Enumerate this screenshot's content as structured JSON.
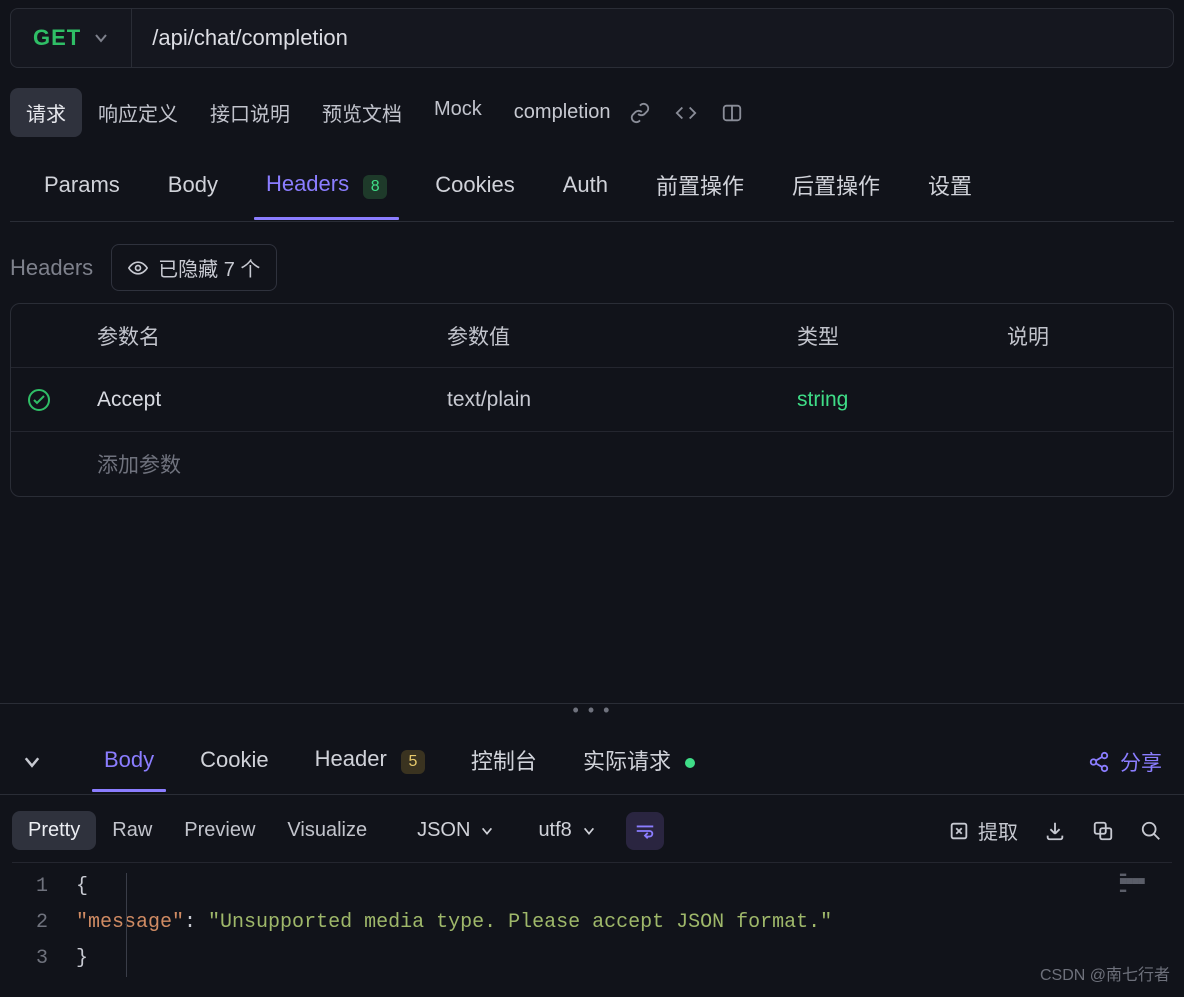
{
  "request": {
    "method": "GET",
    "url": "/api/chat/completion"
  },
  "subtabs": {
    "items": [
      "请求",
      "响应定义",
      "接口说明",
      "预览文档",
      "Mock"
    ],
    "active": 0,
    "breadcrumb": "completion"
  },
  "tabs": {
    "params": "Params",
    "body": "Body",
    "headers": "Headers",
    "headers_badge": "8",
    "cookies": "Cookies",
    "auth": "Auth",
    "pre": "前置操作",
    "post": "后置操作",
    "settings": "设置",
    "active": "headers"
  },
  "headers_section": {
    "title": "Headers",
    "hidden_label": "已隐藏 7 个",
    "columns": {
      "name": "参数名",
      "value": "参数值",
      "type": "类型",
      "desc": "说明"
    },
    "rows": [
      {
        "enabled": true,
        "name": "Accept",
        "value": "text/plain",
        "type": "string",
        "desc": ""
      }
    ],
    "add_placeholder": "添加参数"
  },
  "response": {
    "tabs": {
      "body": "Body",
      "cookie": "Cookie",
      "header": "Header",
      "header_badge": "5",
      "console": "控制台",
      "actual": "实际请求",
      "active": "body"
    },
    "share_label": "分享",
    "view": {
      "modes": [
        "Pretty",
        "Raw",
        "Preview",
        "Visualize"
      ],
      "active": 0,
      "format": "JSON",
      "encoding": "utf8"
    },
    "extract_label": "提取",
    "body_json": {
      "lines": [
        {
          "n": "1",
          "tokens": [
            {
              "t": "{",
              "c": "punct"
            }
          ]
        },
        {
          "n": "2",
          "tokens": [
            {
              "t": "    ",
              "c": "punct"
            },
            {
              "t": "\"message\"",
              "c": "key"
            },
            {
              "t": ": ",
              "c": "punct"
            },
            {
              "t": "\"Unsupported media type. Please accept JSON format.\"",
              "c": "str"
            }
          ]
        },
        {
          "n": "3",
          "tokens": [
            {
              "t": "}",
              "c": "punct"
            }
          ]
        }
      ]
    }
  },
  "watermark": "CSDN @南七行者"
}
